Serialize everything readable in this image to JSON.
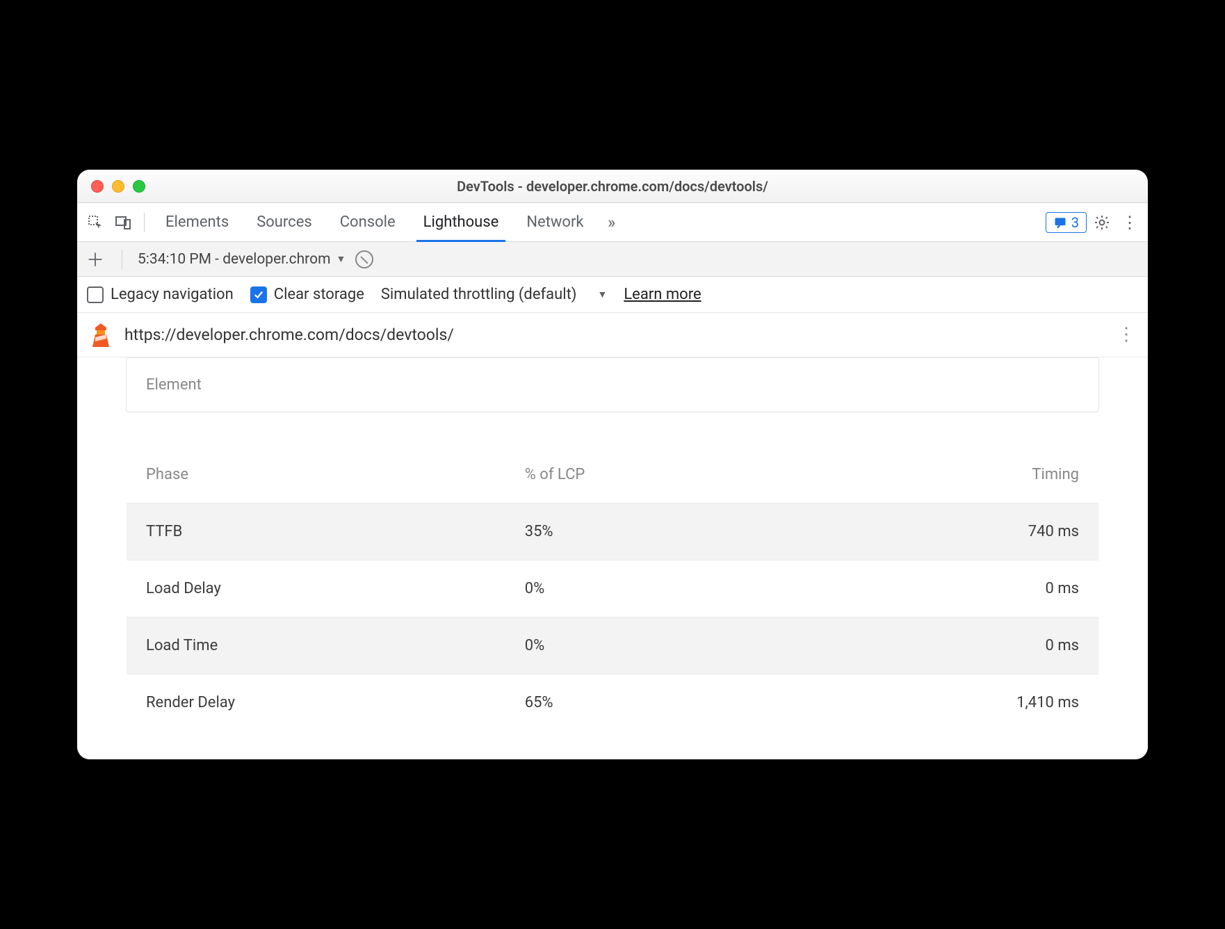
{
  "window": {
    "title": "DevTools - developer.chrome.com/docs/devtools/"
  },
  "tabs": {
    "items": [
      "Elements",
      "Sources",
      "Console",
      "Lighthouse",
      "Network"
    ],
    "active": "Lighthouse",
    "overflow_icon": "»",
    "messages_count": "3"
  },
  "report_toolbar": {
    "dropdown_label": "5:34:10 PM - developer.chrom"
  },
  "settings": {
    "legacy_label": "Legacy navigation",
    "legacy_checked": false,
    "clear_label": "Clear storage",
    "clear_checked": true,
    "throttling_label": "Simulated throttling (default)",
    "learn_more": "Learn more"
  },
  "url_row": {
    "url": "https://developer.chrome.com/docs/devtools/"
  },
  "element_box": {
    "label": "Element"
  },
  "lcp_table": {
    "headers": {
      "phase": "Phase",
      "pct": "% of LCP",
      "timing": "Timing"
    },
    "rows": [
      {
        "phase": "TTFB",
        "pct": "35%",
        "timing": "740 ms"
      },
      {
        "phase": "Load Delay",
        "pct": "0%",
        "timing": "0 ms"
      },
      {
        "phase": "Load Time",
        "pct": "0%",
        "timing": "0 ms"
      },
      {
        "phase": "Render Delay",
        "pct": "65%",
        "timing": "1,410 ms"
      }
    ]
  }
}
